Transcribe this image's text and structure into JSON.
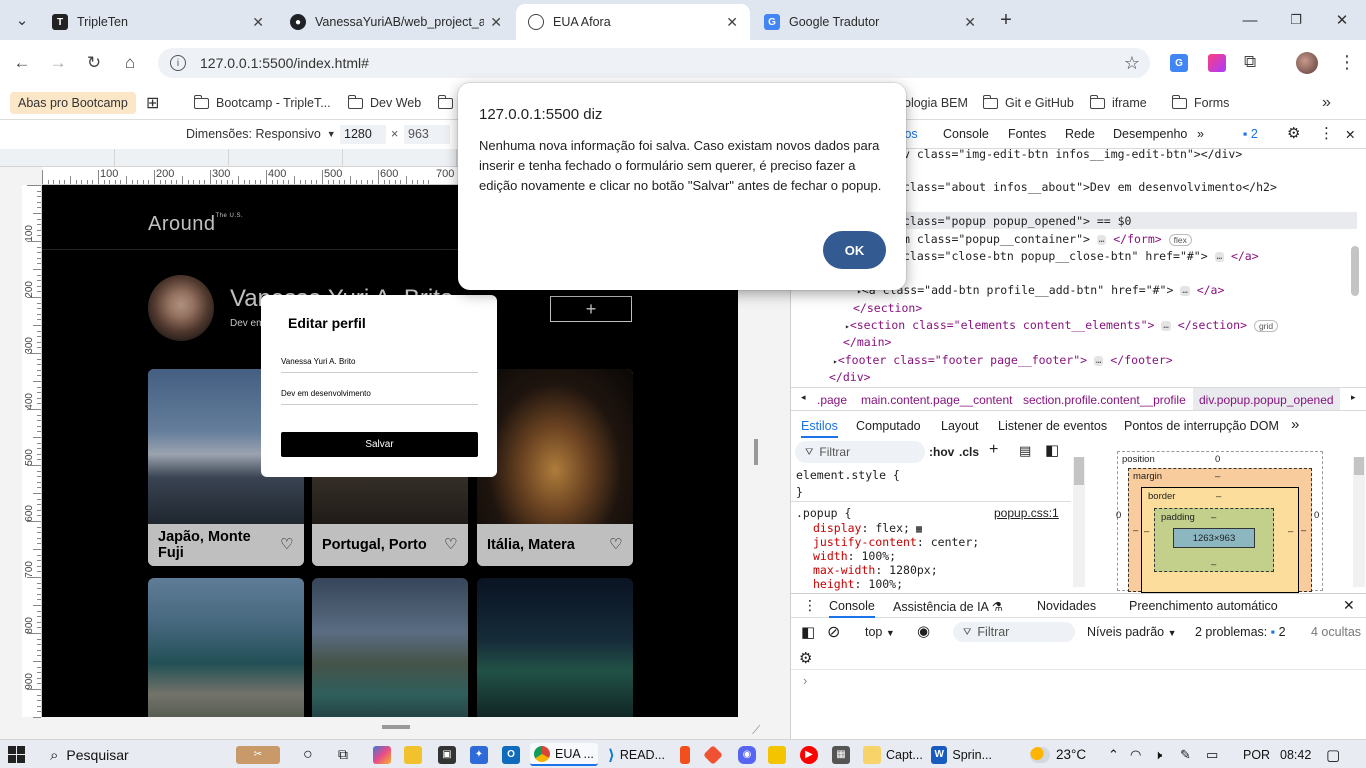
{
  "tabs": [
    {
      "title": "TripleTen",
      "icon": "tripleten-icon"
    },
    {
      "title": "VanessaYuriAB/web_project_ard",
      "icon": "github-icon"
    },
    {
      "title": "EUA Afora",
      "icon": "globe-icon"
    },
    {
      "title": "Google Tradutor",
      "icon": "translate-icon"
    }
  ],
  "omnibox": {
    "url": "127.0.0.1:5500/index.html#"
  },
  "bookmarks": {
    "first": "Abas pro Bootcamp",
    "items": [
      "Bootcamp - TripleT...",
      "Dev Web",
      "ologia BEM",
      "Git e GitHub",
      "iframe",
      "Forms"
    ]
  },
  "responsive": {
    "label": "Dimensões: Responsivo",
    "width": "1280",
    "times": "×",
    "height": "963"
  },
  "ruler": {
    "h": [
      "100",
      "200",
      "300",
      "400",
      "500",
      "600",
      "700"
    ],
    "v": [
      "100",
      "200",
      "300",
      "400",
      "500",
      "600",
      "700",
      "800",
      "900"
    ]
  },
  "site": {
    "logo": "Around",
    "logo_sup": "The U.S.",
    "profile_name": "Vanessa Yuri A. Brito",
    "profile_about": "Dev em desenvolvimento",
    "add_symbol": "+",
    "cards": [
      {
        "title": "Japão, Monte Fuji"
      },
      {
        "title": "Portugal, Porto"
      },
      {
        "title": "Itália, Matera"
      }
    ]
  },
  "popup": {
    "title": "Editar perfil",
    "name_value": "Vanessa Yuri A. Brito",
    "about_value": "Dev em desenvolvimento",
    "save_label": "Salvar"
  },
  "alert": {
    "origin": "127.0.0.1:5500 diz",
    "message": "Nenhuma nova informação foi salva. Caso existam novos dados para inserir e tenha fechado o formulário sem querer, é preciso fazer a edição novamente e clicar no botão \"Salvar\" antes de fechar o popup.",
    "ok_label": "OK"
  },
  "devtools": {
    "tabs": [
      "tos",
      "Console",
      "Fontes",
      "Rede",
      "Desempenho"
    ],
    "issues_count": "2",
    "dom_lines": [
      "v class=\"img-edit-btn infos__img-edit-btn\"></div>",
      "class=\"about infos__about\">Dev em desenvolvimento</h2>",
      "class=\"popup popup_opened\"> == $0",
      "m class=\"popup__container\">",
      "class=\"close-btn popup__close-btn\" href=\"#\">",
      "<a class=\"add-btn profile__add-btn\" href=\"#\">",
      "</section>",
      "<section class=\"elements content__elements\">",
      "</main>",
      "<footer class=\"footer page__footer\">",
      "</div>"
    ],
    "dom_dollar": "== $0",
    "pills": {
      "flex": "flex",
      "grid": "grid"
    },
    "breadcrumbs": [
      ".page",
      "main.content.page__content",
      "section.profile.content__profile",
      "div.popup.popup_opened"
    ],
    "styles_tabs": [
      "Estilos",
      "Computado",
      "Layout",
      "Listener de eventos",
      "Pontos de interrupção DOM"
    ],
    "filter_placeholder": "Filtrar",
    "hov": ":hov",
    "cls": ".cls",
    "element_style": "element.style {",
    "close_brace": "}",
    "rule_selector": ".popup {",
    "rule_source": "popup.css:1",
    "declarations": [
      {
        "prop": "display",
        "value": "flex;"
      },
      {
        "prop": "justify-content",
        "value": "center;"
      },
      {
        "prop": "width",
        "value": "100%;"
      },
      {
        "prop": "max-width",
        "value": "1280px;"
      },
      {
        "prop": "height",
        "value": "100%;"
      }
    ],
    "boxmodel": {
      "position": "position",
      "position_value": "0",
      "margin": "margin",
      "border": "border",
      "padding": "padding",
      "content": "1263×963",
      "dash": "–",
      "zero": "0"
    },
    "drawer_tabs": [
      "Console",
      "Assistência de IA",
      "Novidades",
      "Preenchimento automático"
    ],
    "console_toolbar": {
      "context": "top",
      "filter": "Filtrar",
      "levels": "Níveis padrão",
      "problems": "2 problemas:",
      "problems_count": "2",
      "hidden": "4 ocultas"
    }
  },
  "taskbar": {
    "search": "Pesquisar",
    "chrome_label": "EUA ...",
    "vscode_label": "READ...",
    "capt_label": "Capt...",
    "word_label": "Sprin...",
    "temperature": "23°C",
    "lang": "POR",
    "time": "08:42"
  },
  "colors": {
    "ok_button": "#335a91",
    "tabstrip": "#dfe6ef",
    "selected_node": "#e8eaed"
  }
}
